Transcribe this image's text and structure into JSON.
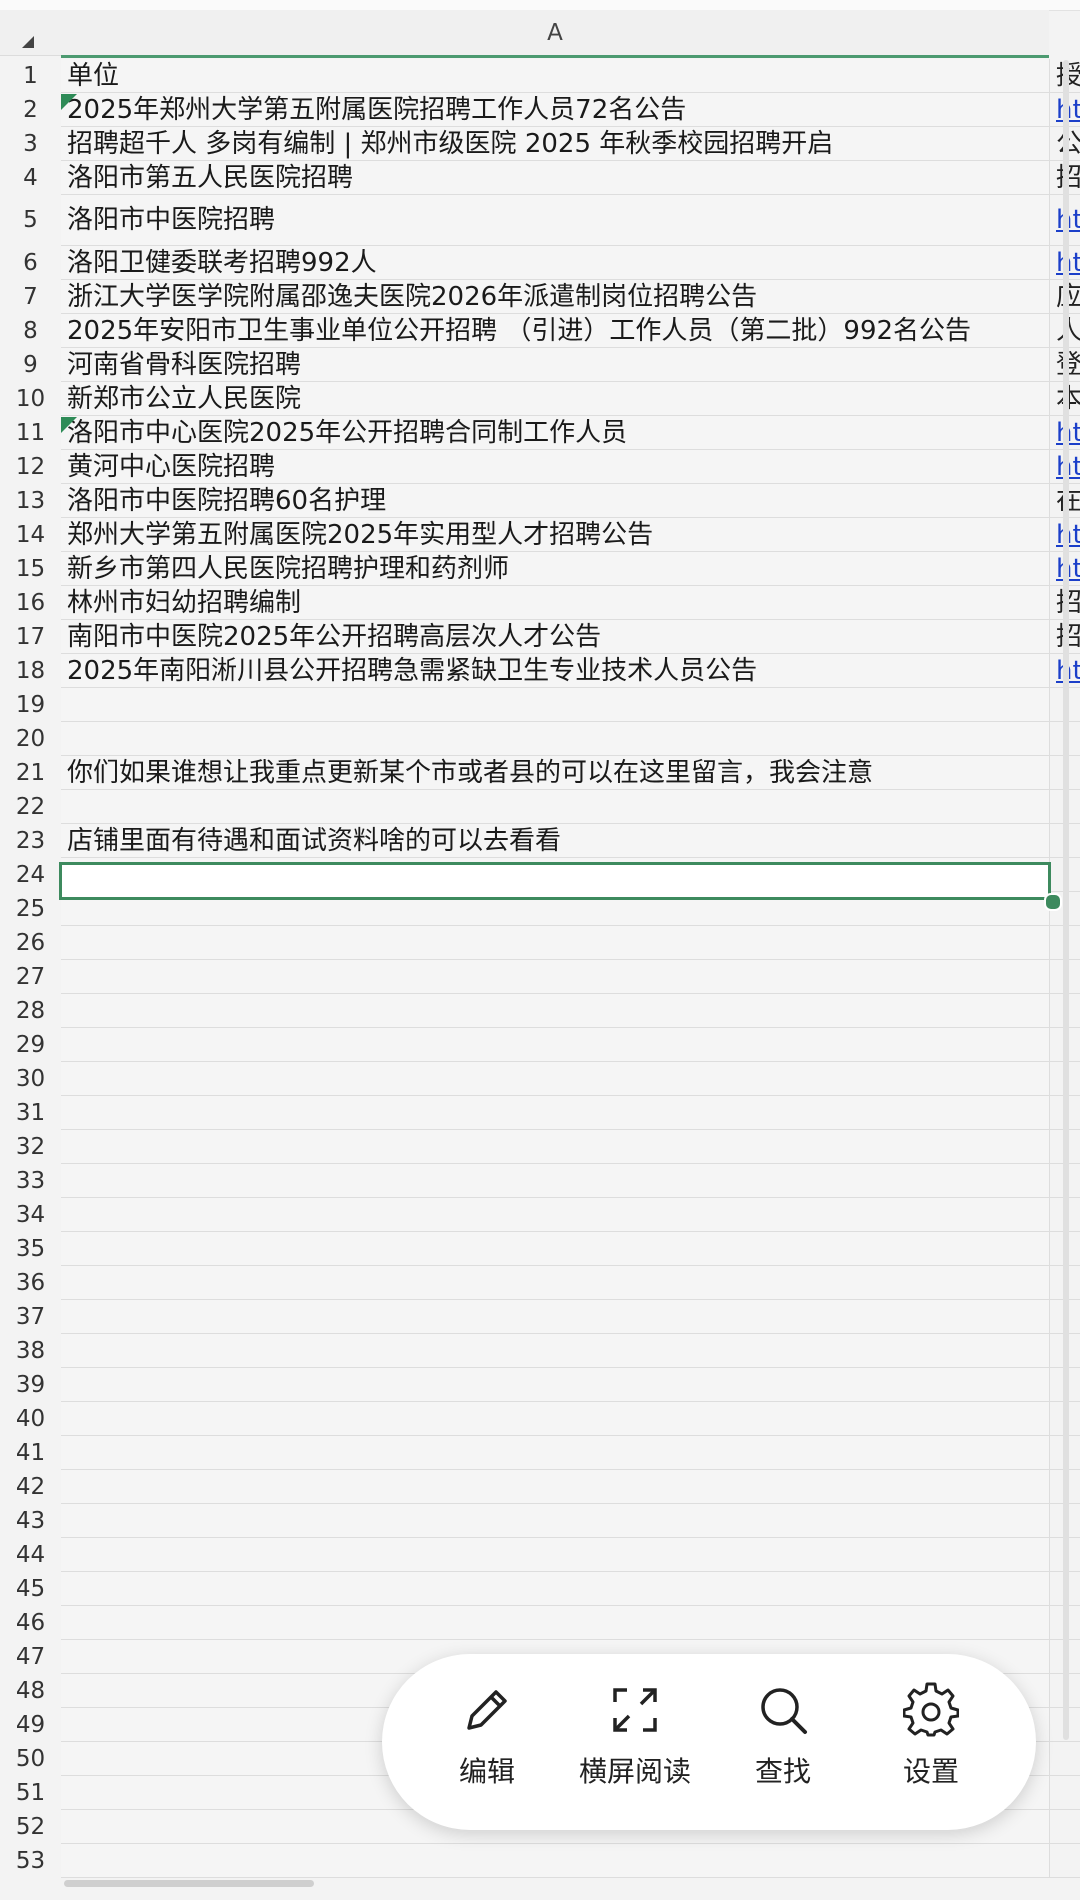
{
  "sheet": {
    "column_header": "A",
    "rows": [
      {
        "num": "1",
        "a": "单位",
        "next": "授",
        "next_link": false
      },
      {
        "num": "2",
        "a": "2025年郑州大学第五附属医院招聘工作人员72名公告",
        "next": "ht",
        "next_link": true,
        "comment": true
      },
      {
        "num": "3",
        "a": "招聘超千人 多岗有编制 | 郑州市级医院 2025 年秋季校园招聘开启",
        "next": "公",
        "next_link": false
      },
      {
        "num": "4",
        "a": "洛阳市第五人民医院招聘",
        "next": "招",
        "next_link": false
      },
      {
        "num": "5",
        "a": "洛阳市中医院招聘",
        "next": "ht",
        "next_link": true
      },
      {
        "num": "6",
        "a": "洛阳卫健委联考招聘992人",
        "next": "ht",
        "next_link": true
      },
      {
        "num": "7",
        "a": "浙江大学医学院附属邵逸夫医院2026年派遣制岗位招聘公告",
        "next": "应",
        "next_link": false
      },
      {
        "num": "8",
        "a": "2025年安阳市卫生事业单位公开招聘 （引进）工作人员（第二批）992名公告",
        "next": "人",
        "next_link": false
      },
      {
        "num": "9",
        "a": "河南省骨科医院招聘",
        "next": "登",
        "next_link": false
      },
      {
        "num": "10",
        "a": "新郑市公立人民医院",
        "next": "本",
        "next_link": false
      },
      {
        "num": "11",
        "a": "洛阳市中心医院2025年公开招聘合同制工作人员",
        "next": "ht",
        "next_link": true,
        "comment": true
      },
      {
        "num": "12",
        "a": "黄河中心医院招聘",
        "next": "ht",
        "next_link": true
      },
      {
        "num": "13",
        "a": "洛阳市中医院招聘60名护理",
        "next": "在",
        "next_link": false
      },
      {
        "num": "14",
        "a": "郑州大学第五附属医院2025年实用型人才招聘公告",
        "next": "ht",
        "next_link": true
      },
      {
        "num": "15",
        "a": "新乡市第四人民医院招聘护理和药剂师",
        "next": "ht",
        "next_link": true
      },
      {
        "num": "16",
        "a": "林州市妇幼招聘编制",
        "next": "招",
        "next_link": false
      },
      {
        "num": "17",
        "a": "南阳市中医院2025年公开招聘高层次人才公告",
        "next": "招",
        "next_link": false
      },
      {
        "num": "18",
        "a": "2025年南阳淅川县公开招聘急需紧缺卫生专业技术人员公告",
        "next": "ht",
        "next_link": true
      },
      {
        "num": "19",
        "a": ""
      },
      {
        "num": "20",
        "a": ""
      },
      {
        "num": "21",
        "a": "你们如果谁想让我重点更新某个市或者县的可以在这里留言，我会注意"
      },
      {
        "num": "22",
        "a": ""
      },
      {
        "num": "23",
        "a": "店铺里面有待遇和面试资料啥的可以去看看"
      },
      {
        "num": "24",
        "a": ""
      },
      {
        "num": "25",
        "a": ""
      },
      {
        "num": "26",
        "a": ""
      },
      {
        "num": "27",
        "a": ""
      },
      {
        "num": "28",
        "a": ""
      },
      {
        "num": "29",
        "a": ""
      },
      {
        "num": "30",
        "a": ""
      },
      {
        "num": "31",
        "a": ""
      },
      {
        "num": "32",
        "a": ""
      },
      {
        "num": "33",
        "a": ""
      },
      {
        "num": "34",
        "a": ""
      },
      {
        "num": "35",
        "a": ""
      },
      {
        "num": "36",
        "a": ""
      },
      {
        "num": "37",
        "a": ""
      },
      {
        "num": "38",
        "a": ""
      },
      {
        "num": "39",
        "a": ""
      },
      {
        "num": "40",
        "a": ""
      },
      {
        "num": "41",
        "a": ""
      },
      {
        "num": "42",
        "a": ""
      },
      {
        "num": "43",
        "a": ""
      },
      {
        "num": "44",
        "a": ""
      },
      {
        "num": "45",
        "a": ""
      },
      {
        "num": "46",
        "a": ""
      },
      {
        "num": "47",
        "a": ""
      },
      {
        "num": "48",
        "a": ""
      },
      {
        "num": "49",
        "a": ""
      },
      {
        "num": "50",
        "a": ""
      },
      {
        "num": "51",
        "a": ""
      },
      {
        "num": "52",
        "a": ""
      },
      {
        "num": "53",
        "a": ""
      }
    ],
    "selected_cell": "A24"
  },
  "toolbar": {
    "edit_label": "编辑",
    "landscape_label": "横屏阅读",
    "find_label": "查找",
    "settings_label": "设置",
    "icons": [
      "pencil-icon",
      "expand-icon",
      "search-icon",
      "gear-icon"
    ]
  },
  "colors": {
    "selection": "#3d8a5e",
    "link": "#1b3fc9",
    "comment_marker": "#2e8b57"
  }
}
